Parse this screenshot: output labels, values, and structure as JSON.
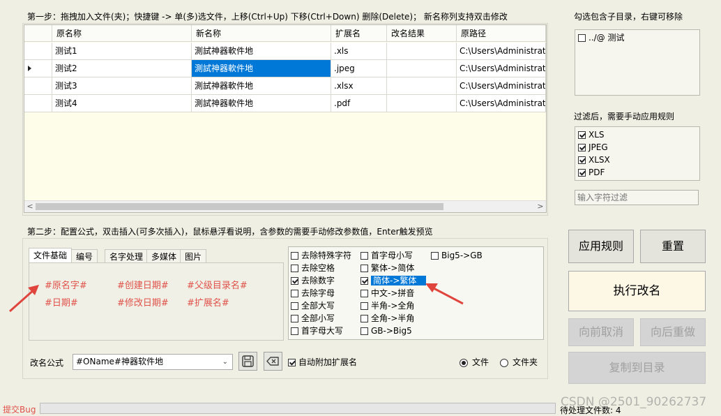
{
  "step1": {
    "title": "第一步：拖拽加入文件(夹)；快捷键 -> 单(多)选文件，上移(Ctrl+Up) 下移(Ctrl+Down) 删除(Delete)；  新名称列支持双击修改",
    "columns": [
      "原名称",
      "新名称",
      "扩展名",
      "改名结果",
      "原路径"
    ],
    "rows": [
      {
        "orig": "测试1",
        "new": "測試神器軟件地",
        "ext": ".xls",
        "result": "",
        "path": "C:\\Users\\Administrato"
      },
      {
        "orig": "测试2",
        "new": "測試神器軟件地",
        "ext": ".jpeg",
        "result": "",
        "path": "C:\\Users\\Administrato"
      },
      {
        "orig": "测试3",
        "new": "測試神器軟件地",
        "ext": ".xlsx",
        "result": "",
        "path": "C:\\Users\\Administrato"
      },
      {
        "orig": "测试4",
        "new": "測試神器軟件地",
        "ext": ".pdf",
        "result": "",
        "path": "C:\\Users\\Administrato"
      }
    ],
    "current_row": 1,
    "scroll_left": "<",
    "scroll_right": ">"
  },
  "subdir": {
    "title": "勾选包含子目录，右键可移除",
    "items": [
      {
        "label": "../@ 测试",
        "checked": false
      }
    ]
  },
  "filter": {
    "title": "过滤后，需要手动应用规则",
    "items": [
      {
        "label": "XLS",
        "checked": true
      },
      {
        "label": "JPEG",
        "checked": true
      },
      {
        "label": "XLSX",
        "checked": true
      },
      {
        "label": "PDF",
        "checked": true
      }
    ],
    "input_placeholder": "输入字符过滤"
  },
  "step2": {
    "title": "第二步：配置公式，双击插入(可多次插入)，鼠标悬浮看说明，含参数的需要手动修改参数值，Enter触发预览",
    "tabs": [
      "文件基础",
      "编号",
      "名字处理",
      "多媒体",
      "图片"
    ],
    "active_tab": 0,
    "vars": [
      "#原名字#",
      "#创建日期#",
      "#父级目录名#",
      "#日期#",
      "#修改日期#",
      "#扩展名#"
    ],
    "options_col1": [
      {
        "label": "去除特殊字符",
        "checked": false
      },
      {
        "label": "去除空格",
        "checked": false
      },
      {
        "label": "去除数字",
        "checked": true
      },
      {
        "label": "去除字母",
        "checked": false
      },
      {
        "label": "全部大写",
        "checked": false
      },
      {
        "label": "全部小写",
        "checked": false
      },
      {
        "label": "首字母大写",
        "checked": false
      }
    ],
    "options_col2": [
      {
        "label": "首字母小写",
        "checked": false
      },
      {
        "label": "繁体->简体",
        "checked": false
      },
      {
        "label": "简体->繁体",
        "checked": true,
        "highlight": true
      },
      {
        "label": "中文->拼音",
        "checked": false
      },
      {
        "label": "半角->全角",
        "checked": false
      },
      {
        "label": "全角->半角",
        "checked": false
      },
      {
        "label": "GB->Big5",
        "checked": false
      }
    ],
    "options_col3": [
      {
        "label": "Big5->GB",
        "checked": false
      }
    ],
    "formula_label": "改名公式",
    "formula_value": "#OName#神器软件地",
    "auto_ext_label": "自动附加扩展名",
    "auto_ext_checked": true,
    "radio_file": "文件",
    "radio_folder": "文件夹",
    "radio_selected": "file"
  },
  "buttons": {
    "apply": "应用规则",
    "reset": "重置",
    "execute": "执行改名",
    "undo": "向前取消",
    "redo": "向后重做",
    "copy": "复制到目录"
  },
  "status": {
    "bug_link": "提交Bug",
    "pending_label": "待处理文件数: 4",
    "watermark": "CSDN @2501_90262737"
  },
  "colors": {
    "selection": "#0078d7",
    "variable_text": "#e0524a",
    "annotation_arrow": "#e0453d",
    "bug_link": "#e0524a"
  }
}
